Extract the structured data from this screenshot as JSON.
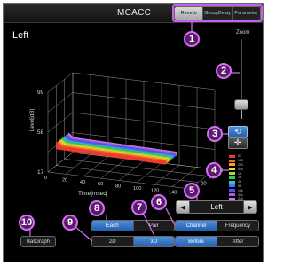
{
  "app": {
    "title": "MCACC"
  },
  "tabs": [
    {
      "label": "Reverb",
      "active": true
    },
    {
      "label": "GroupDelay",
      "active": false
    },
    {
      "label": "Parameter",
      "active": false
    }
  ],
  "channel_title": "Left",
  "zoom": {
    "label": "Zoom",
    "level": 0.2
  },
  "graph": {
    "y_label": "Level[dB]",
    "x_label": "Time[msec]",
    "y_ticks": [
      "99",
      "58",
      "17"
    ],
    "x_ticks": [
      "0",
      "20",
      "40",
      "60",
      "80",
      "100",
      "120",
      "140",
      "160"
    ],
    "z_ticks": [
      "0",
      "20",
      "40",
      "60"
    ]
  },
  "legend": [
    {
      "label": "63",
      "color": "#f03a2e"
    },
    {
      "label": "125",
      "color": "#f56a28"
    },
    {
      "label": "250",
      "color": "#f7a42a"
    },
    {
      "label": "500",
      "color": "#f2d732"
    },
    {
      "label": "1k",
      "color": "#9fdc3a"
    },
    {
      "label": "2k",
      "color": "#35c85a"
    },
    {
      "label": "4k",
      "color": "#2fc0c8"
    },
    {
      "label": "8k",
      "color": "#3c7cf0"
    },
    {
      "label": "16k",
      "color": "#5a4ef2"
    },
    {
      "label": "32k",
      "color": "#a35cf0"
    },
    {
      "label": "Zeit",
      "color": "#d07ae8"
    }
  ],
  "channel_selector": {
    "prev_symbol": "◀",
    "value": "Left",
    "next_symbol": "▶"
  },
  "segments": {
    "channel_frequency": {
      "options": [
        "Channel",
        "Frequency"
      ],
      "selected": "Channel"
    },
    "each_pair": {
      "options": [
        "Each",
        "Pair"
      ],
      "selected": "Each"
    },
    "before_after": {
      "options": [
        "Before",
        "After"
      ],
      "selected": "Before"
    },
    "dimension": {
      "options": [
        "2D",
        "3D"
      ],
      "selected": "3D"
    }
  },
  "bargraph_label": "BarGraph",
  "buttons": {
    "reset_icon": "refresh-icon",
    "move_icon": "move-icon"
  },
  "callouts": [
    "1",
    "2",
    "3",
    "4",
    "5",
    "6",
    "7",
    "8",
    "9",
    "10"
  ],
  "accent": {
    "callout": "#d76ff2",
    "selected": "#3a78d0"
  }
}
